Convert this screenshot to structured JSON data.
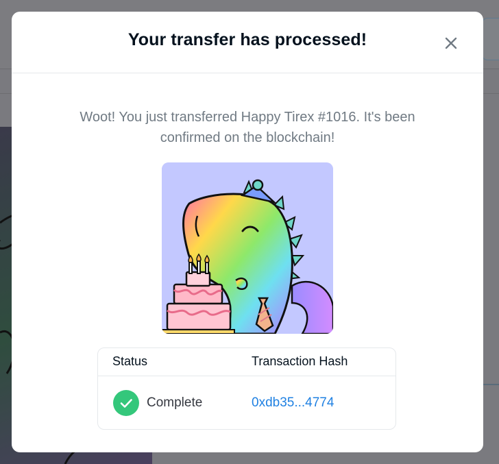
{
  "modal": {
    "title": "Your transfer has processed!",
    "close_icon": "close-icon",
    "message": "Woot! You just transferred Happy Tirex #1016. It's been confirmed on the blockchain!",
    "nft_image_icon": "dinosaur-birthday-cake-art"
  },
  "status_table": {
    "headers": {
      "status": "Status",
      "hash": "Transaction Hash"
    },
    "row": {
      "status": "Complete",
      "status_icon": "checkmark-icon",
      "hash": "0xdb35...4774"
    }
  },
  "colors": {
    "overlay": "#7a7a7f",
    "title": "#04111d",
    "message": "#707a83",
    "link": "#2081e2",
    "success": "#34c77b",
    "nft_background": "#c3c8ff"
  }
}
